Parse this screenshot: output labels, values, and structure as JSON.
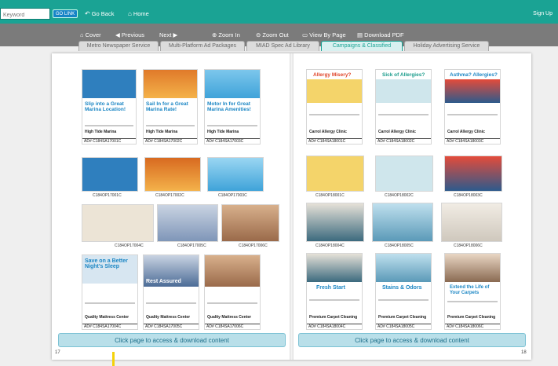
{
  "topbar": {
    "keyword_placeholder": "Keyword",
    "go_label": "GO LINK",
    "go_back": "Go Back",
    "home": "Home",
    "sign_up": "Sign Up"
  },
  "toolbar": {
    "cover": "Cover",
    "previous": "Previous",
    "next": "Next",
    "zoom_in": "Zoom In",
    "zoom_out": "Zoom Out",
    "view_by_page": "View By Page",
    "download_pdf": "Download PDF"
  },
  "tabs": [
    {
      "label": "Metro Newspaper Service",
      "active": false
    },
    {
      "label": "Multi-Platform Ad Packages",
      "active": false
    },
    {
      "label": "MIAD Spec Ad Library",
      "active": false
    },
    {
      "label": "Campaigns & Classified",
      "active": true
    },
    {
      "label": "Holiday Advertising Service",
      "active": false
    }
  ],
  "left_page": {
    "ads": [
      {
        "headline": "Slip into a Great Marina Location!",
        "business": "High Tide Marina",
        "tag": "AD# C184SA17001C",
        "photo_color": "#2f7fbe"
      },
      {
        "headline": "Sail In for a Great Marina Rate!",
        "business": "High Tide Marina",
        "tag": "AD# C184SA17002C",
        "photo_color": "#e07a2a"
      },
      {
        "headline": "Motor In for Great Marina Amenities!",
        "business": "High Tide Marina",
        "tag": "AD# C184SA17003C",
        "photo_color": "#3fa3d9"
      }
    ],
    "photos_row2": [
      "C184OP17001C",
      "C184OP17002C",
      "C184OP17003C"
    ],
    "photos_row3": [
      "C184OP17004C",
      "C184OP17005C",
      "C184OP17006C"
    ],
    "ads_row4": [
      {
        "headline": "Save on a Better Night's Sleep",
        "business": "Quality Mattress Center",
        "tag": "AD# C184SA17004C"
      },
      {
        "headline": "Rest Assured",
        "business": "Quality Mattress Center",
        "tag": "AD# C184SA17005C"
      },
      {
        "headline": "",
        "business": "Quality Mattress Center",
        "tag": "AD# C184SA17006C"
      }
    ],
    "cta": "Click page to access & download content",
    "page_number": "17"
  },
  "right_page": {
    "ads": [
      {
        "headline": "Allergy Misery?",
        "business": "Carrol Allergy Clinic",
        "tag": "AD# C184SA18001C"
      },
      {
        "headline": "Sick of Allergies?",
        "business": "Carrol Allergy Clinic",
        "tag": "AD# C184SA18002C"
      },
      {
        "headline": "Asthma? Allergies?",
        "business": "Carrol Allergy Clinic",
        "tag": "AD# C184SA18003C"
      }
    ],
    "photos_row2": [
      "C184OP18001C",
      "C184OP18002C",
      "C184OP18003C"
    ],
    "photos_row3": [
      "C184OP18004C",
      "C184OP18005C",
      "C184OP18006C"
    ],
    "ads_row4": [
      {
        "headline": "Fresh Start",
        "business": "Premium Carpet Cleaning",
        "tag": "AD# C184SA18004C"
      },
      {
        "headline": "Stains & Odors",
        "business": "Premium Carpet Cleaning",
        "tag": "AD# C184SA18005C"
      },
      {
        "headline": "Extend the Life of Your Carpets",
        "business": "Premium Carpet Cleaning",
        "tag": "AD# C184SA18006C"
      }
    ],
    "cta": "Click page to access & download content",
    "page_number": "18"
  }
}
